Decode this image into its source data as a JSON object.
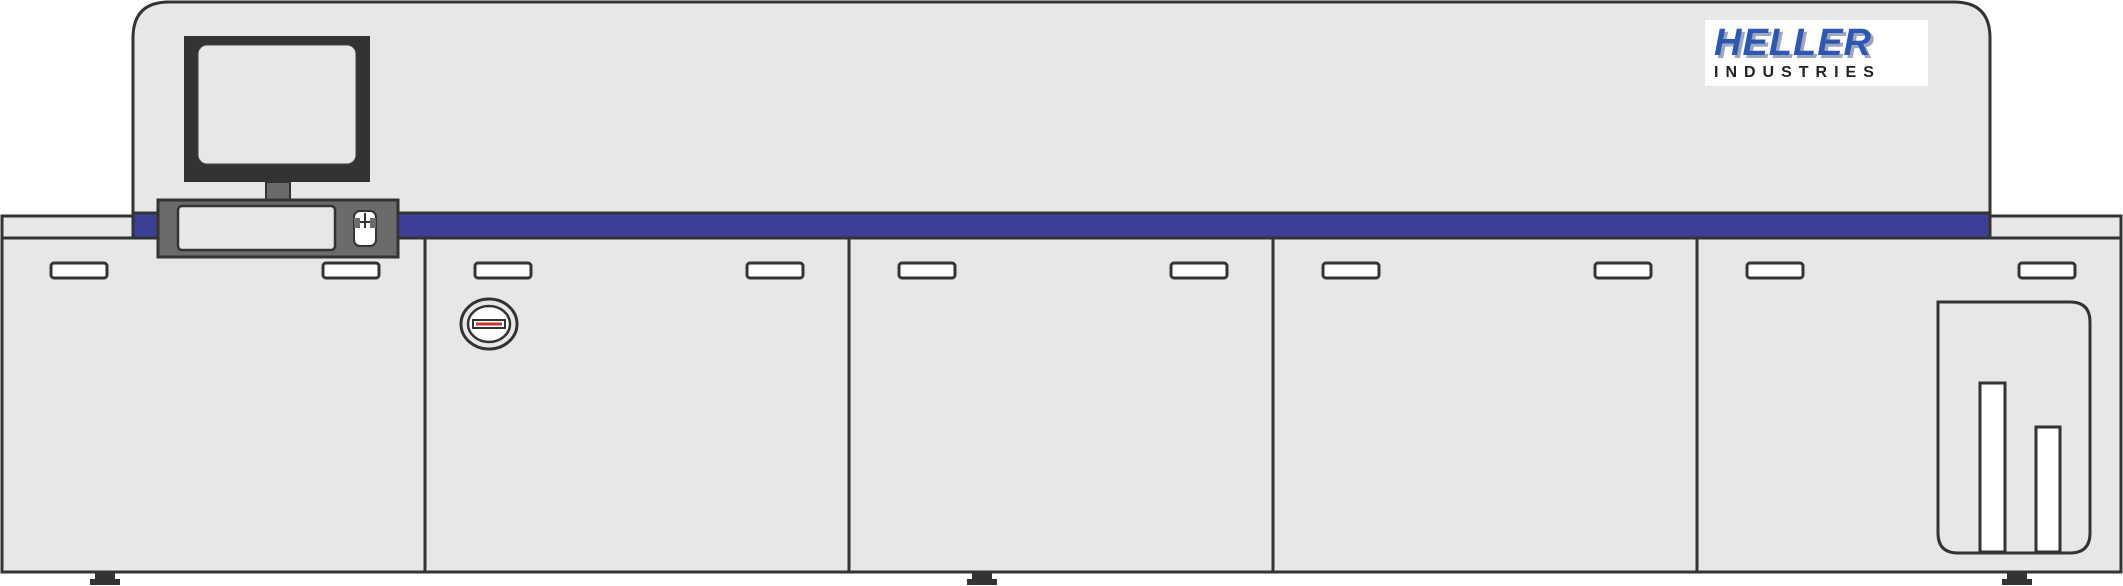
{
  "logo": {
    "brand": "HELLER",
    "subtitle": "INDUSTRIES",
    "brand_color": "#2d57b0",
    "subtitle_color": "#222222"
  },
  "colors": {
    "body": "#e6e7e9",
    "outline": "#333333",
    "conveyor_band": "#3b3f95",
    "monitor_frame": "#333333",
    "console": "#6b6b6b",
    "window_fill": "#ffffff",
    "indicator_red": "#c0392b"
  },
  "icons": {
    "monitor": "monitor-icon",
    "keyboard": "keyboard-icon",
    "mouse": "mouse-icon",
    "status_light": "status-light-icon",
    "cabinet": "cabinet-icon"
  },
  "sections": [
    {
      "name": "section-1"
    },
    {
      "name": "section-2"
    },
    {
      "name": "section-3"
    },
    {
      "name": "section-4"
    },
    {
      "name": "section-5"
    }
  ]
}
